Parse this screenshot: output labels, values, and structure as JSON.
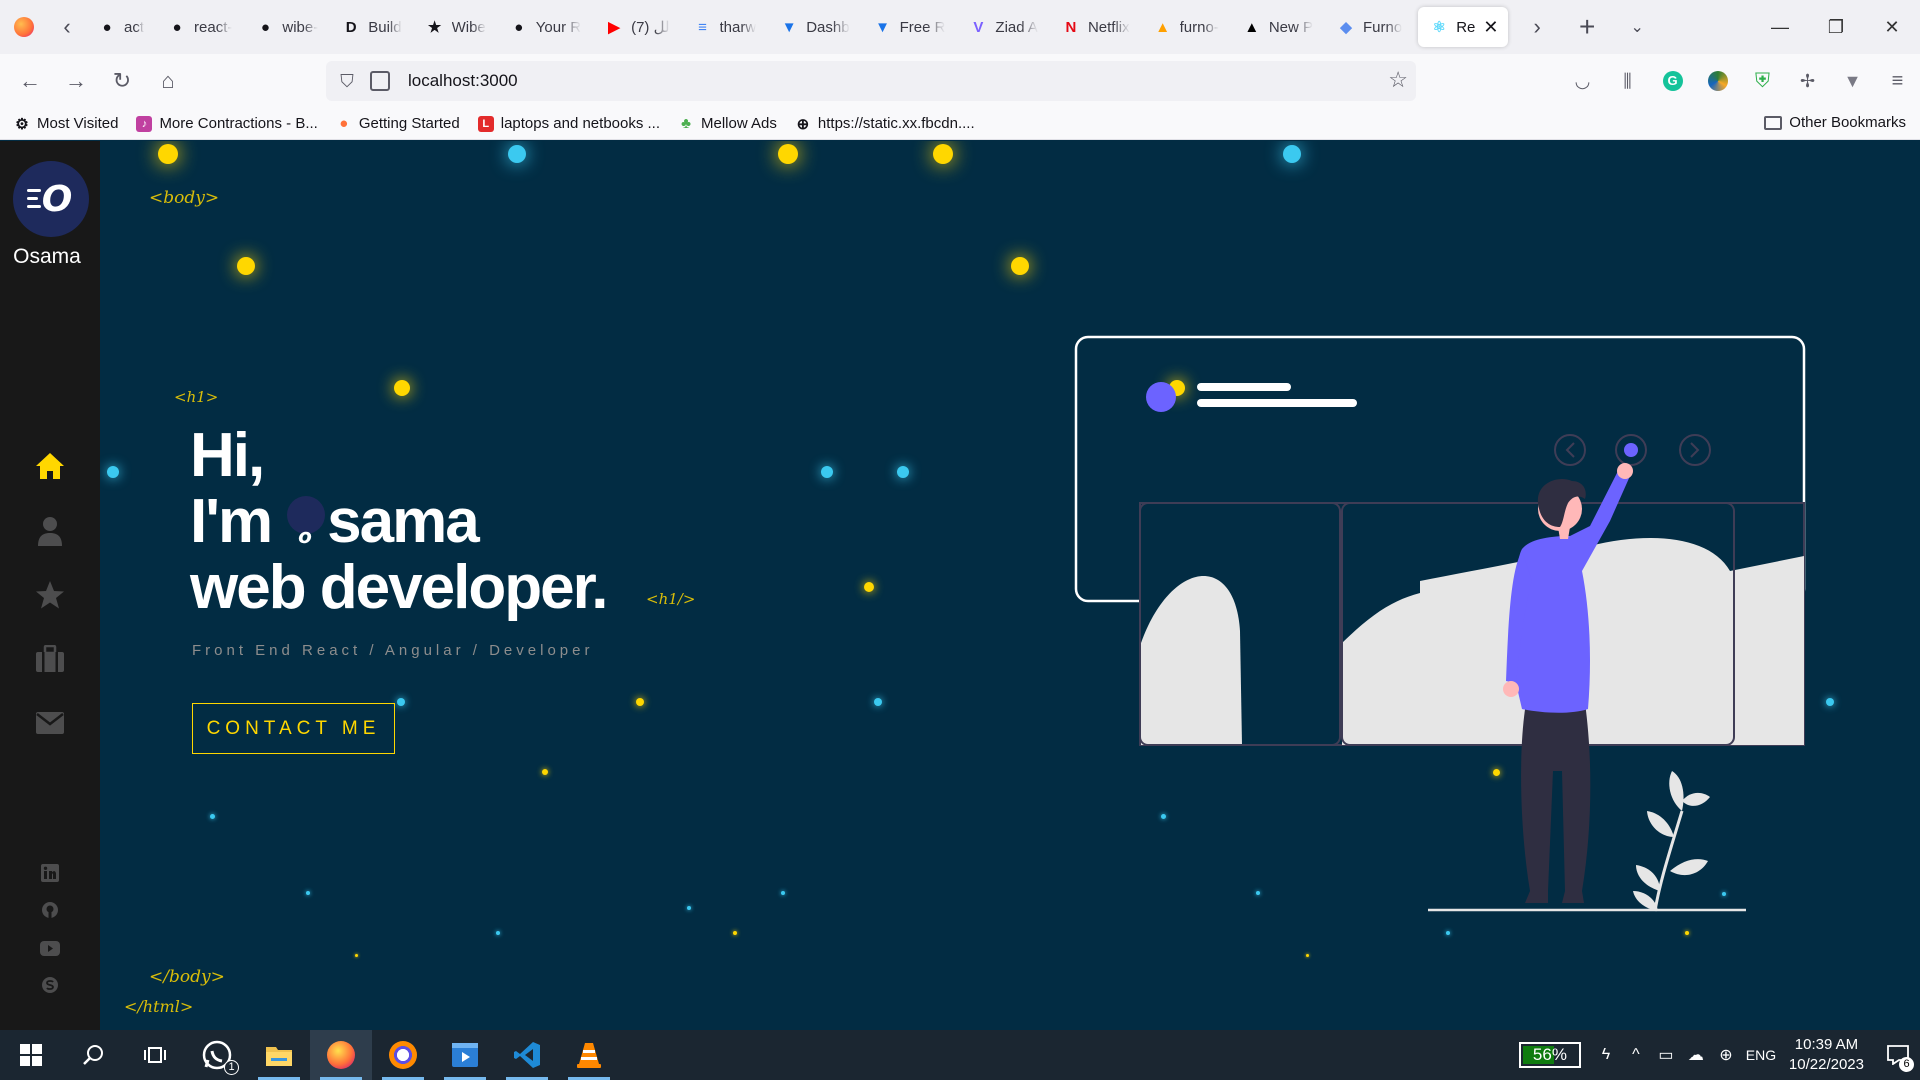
{
  "browser": {
    "tabs": [
      {
        "label": "act",
        "icon": "github-icon",
        "color": "#15141a"
      },
      {
        "label": "react-",
        "icon": "github-icon",
        "color": "#15141a"
      },
      {
        "label": "wibe-",
        "icon": "github-icon",
        "color": "#15141a"
      },
      {
        "label": "Build",
        "icon": "dev-icon",
        "color": "#15141a"
      },
      {
        "label": "Wibe",
        "icon": "star-icon",
        "color": "#15141a"
      },
      {
        "label": "Your R",
        "icon": "github-icon",
        "color": "#15141a"
      },
      {
        "label": "لل (7)",
        "icon": "youtube-icon",
        "color": "#ff0000"
      },
      {
        "label": "tharw",
        "icon": "docs-icon",
        "color": "#4285f4"
      },
      {
        "label": "Dashb",
        "icon": "tie-icon",
        "color": "#1a73e8"
      },
      {
        "label": "Free R",
        "icon": "tie-icon",
        "color": "#1a73e8"
      },
      {
        "label": "Ziad A",
        "icon": "vite-icon",
        "color": "#7b61ff"
      },
      {
        "label": "Netflix",
        "icon": "netflix-icon",
        "color": "#e50914"
      },
      {
        "label": "furno-",
        "icon": "firebase-icon",
        "color": "#ffa000"
      },
      {
        "label": "New P",
        "icon": "vercel-icon",
        "color": "#000000"
      },
      {
        "label": "Furno",
        "icon": "furno-icon",
        "color": "#5b8def"
      }
    ],
    "active_tab": {
      "label": "Re",
      "icon": "react-icon"
    },
    "url": "localhost:3000",
    "bookmarks": [
      {
        "label": "Most Visited",
        "icon": "gear-icon",
        "color": "#15141a"
      },
      {
        "label": "More Contractions - B...",
        "icon": "bookmark-icon",
        "color": "#c040a0"
      },
      {
        "label": "Getting Started",
        "icon": "firefox-icon",
        "color": "#ff7139"
      },
      {
        "label": "laptops and netbooks ...",
        "icon": "l-icon",
        "color": "#e32b2b"
      },
      {
        "label": "Mellow Ads",
        "icon": "tree-icon",
        "color": "#4caf50"
      },
      {
        "label": "https://static.xx.fbcdn....",
        "icon": "globe-icon",
        "color": "#15141a"
      }
    ],
    "other_bookmarks": "Other Bookmarks"
  },
  "site": {
    "logo_letter": "O",
    "name": "Osama",
    "nav": [
      "home-icon",
      "user-icon",
      "star-icon",
      "briefcase-icon",
      "envelope-icon"
    ],
    "social": [
      "linkedin-icon",
      "github-icon",
      "youtube-icon",
      "skype-icon"
    ],
    "tags": {
      "body_open": "<body>",
      "h1_open": "<h1>",
      "h1_close": "<h1/>",
      "body_close": "</body>",
      "html_close": "</html>"
    },
    "hero": {
      "line1": "Hi,",
      "line2_prefix": "I'm",
      "line2_logo": "o",
      "line2_suffix": "sama",
      "line3": "web developer."
    },
    "subtitle": "Front End React / Angular / Developer",
    "contact_button": "CONTACT ME",
    "accent_color": "#ffd700",
    "background_color": "#022c43"
  },
  "taskbar": {
    "apps": [
      "windows-icon",
      "search-icon",
      "task-view-icon",
      "whatsapp-icon",
      "file-explorer-icon",
      "firefox-icon",
      "brave-icon",
      "media-player-icon",
      "vscode-icon",
      "vlc-icon"
    ],
    "whatsapp_badge": "1",
    "battery": "56%",
    "battery_level": 0.56,
    "language": "ENG",
    "time": "10:39 AM",
    "date": "10/22/2023",
    "notifications": "6"
  }
}
